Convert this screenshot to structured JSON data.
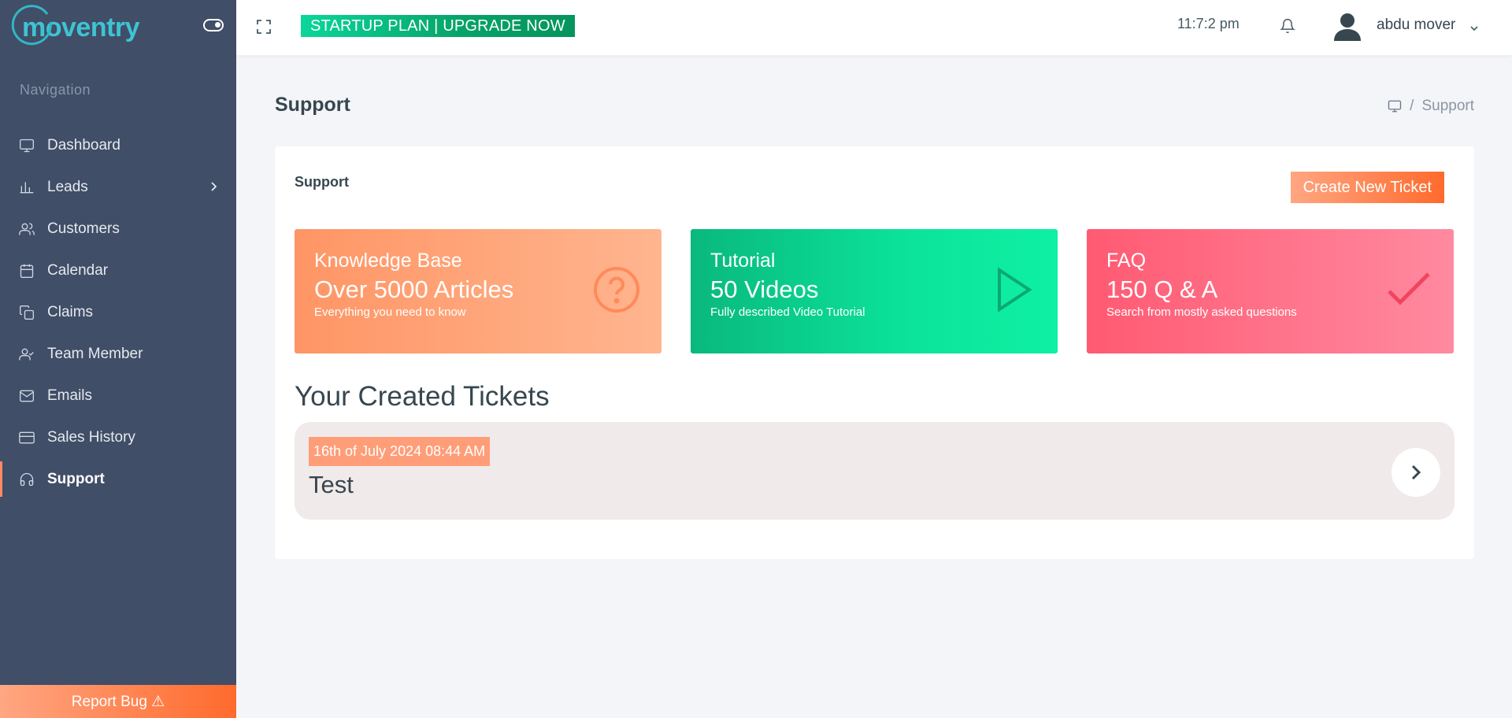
{
  "brand": {
    "logo_text": "moventry",
    "accent": "#3fc3d3"
  },
  "sidebar": {
    "caption": "Navigation",
    "items": [
      {
        "label": "Dashboard",
        "icon": "monitor-icon"
      },
      {
        "label": "Leads",
        "icon": "bar-chart-icon"
      },
      {
        "label": "Customers",
        "icon": "users-icon"
      },
      {
        "label": "Calendar",
        "icon": "calendar-icon"
      },
      {
        "label": "Claims",
        "icon": "copy-icon"
      },
      {
        "label": "Team Member",
        "icon": "user-check-icon"
      },
      {
        "label": "Emails",
        "icon": "mail-icon"
      },
      {
        "label": "Sales History",
        "icon": "credit-card-icon"
      },
      {
        "label": "Support",
        "icon": "headphones-icon"
      }
    ],
    "active": "Support",
    "report_bug": "Report Bug ⚠"
  },
  "topbar": {
    "plan_banner": "STARTUP PLAN | UPGRADE NOW",
    "clock": "11:7:2 pm",
    "user_name": "abdu mover"
  },
  "page": {
    "title": "Support",
    "breadcrumb": [
      "Support"
    ]
  },
  "card": {
    "title": "Support",
    "create_button": "Create New Ticket",
    "tiles": [
      {
        "heading": "Knowledge Base",
        "value": "Over 5000 Articles",
        "subtitle": "Everything you need to know",
        "icon": "question-circle-icon"
      },
      {
        "heading": "Tutorial",
        "value": "50 Videos",
        "subtitle": "Fully described Video Tutorial",
        "icon": "play-icon"
      },
      {
        "heading": "FAQ",
        "value": "150 Q & A",
        "subtitle": "Search from mostly asked questions",
        "icon": "check-icon"
      }
    ],
    "tickets_heading": "Your Created Tickets",
    "tickets": [
      {
        "date": "16th of July 2024 08:44 AM",
        "title": "Test"
      }
    ]
  }
}
